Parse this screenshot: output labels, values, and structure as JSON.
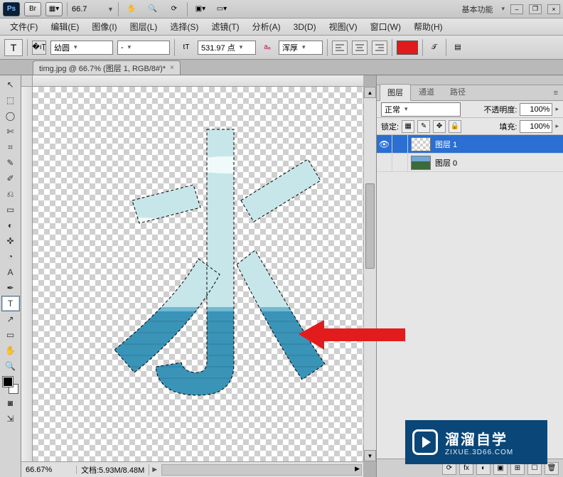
{
  "titlebar": {
    "ps_icon": "Ps",
    "bridge_icon": "Br",
    "mb_icon": "▦▾",
    "zoom": "66.7",
    "hand_icon": "✋",
    "zoomtool_icon": "🔍",
    "rotate_icon": "⟳",
    "arrange_icon": "▣▾",
    "screen_icon": "▭▾",
    "workspace": "基本功能",
    "min": "–",
    "restore": "❐",
    "close": "×"
  },
  "menus": [
    "文件(F)",
    "编辑(E)",
    "图像(I)",
    "图层(L)",
    "选择(S)",
    "滤镜(T)",
    "分析(A)",
    "3D(D)",
    "视图(V)",
    "窗口(W)",
    "帮助(H)"
  ],
  "optbar": {
    "tool": "T",
    "orient_icon": "�ıŢ",
    "font_family": "幼圆",
    "font_style": "-",
    "size_icon": "tT",
    "size_value": "531.97 点",
    "aa_icon": "aₐ",
    "aa_value": "浑厚",
    "align": [
      "left",
      "center",
      "right"
    ],
    "color": "#e01b1b",
    "warp_icon": "𝒯",
    "panel_icon": "▤"
  },
  "document": {
    "tab_title": "timg.jpg @ 66.7% (图层 1, RGB/8#)*",
    "tab_close": "×",
    "status_zoom": "66.67%",
    "status_doc": "文档:5.93M/8.48M"
  },
  "tools": [
    "↖",
    "⬚",
    "◯",
    "✄",
    "⌗",
    "✎",
    "✐",
    "⎌",
    "▭",
    "◐",
    "✜",
    "◔",
    "A",
    "✒",
    "T",
    "↗",
    "▭",
    "✋",
    "🔍"
  ],
  "selected_tool_index": 14,
  "layers_panel": {
    "tabs": [
      "图层",
      "通道",
      "路径"
    ],
    "active_tab": 0,
    "blend_mode": "正常",
    "opacity_label": "不透明度:",
    "opacity_value": "100%",
    "lock_label": "锁定:",
    "lock_icons": [
      "▦",
      "✎",
      "✥",
      "🔒"
    ],
    "fill_label": "填充:",
    "fill_value": "100%",
    "layers": [
      {
        "name": "图层 1",
        "visible": true,
        "selected": true,
        "thumb": "checker"
      },
      {
        "name": "图层 0",
        "visible": false,
        "selected": false,
        "thumb": "photo"
      }
    ],
    "footer_icons": [
      "⟳",
      "fx",
      "◐",
      "▣",
      "⊞",
      "☐",
      "🗑"
    ]
  },
  "watermark": {
    "title": "溜溜自学",
    "sub": "ZIXUE.3D66.COM"
  }
}
